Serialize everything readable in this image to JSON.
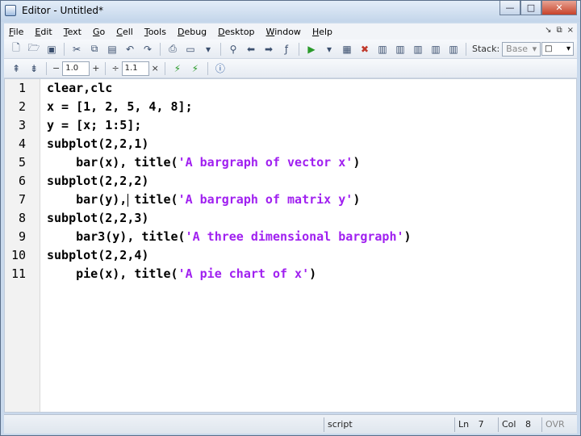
{
  "window": {
    "title": "Editor - Untitled*",
    "minimize": "—",
    "maximize": "□",
    "close": "✕"
  },
  "menu": {
    "items": [
      "File",
      "Edit",
      "Text",
      "Go",
      "Cell",
      "Tools",
      "Debug",
      "Desktop",
      "Window",
      "Help"
    ],
    "right_icons": [
      "↘",
      "⧉",
      "×"
    ]
  },
  "toolbar1": {
    "icons": [
      "new-file-icon",
      "open-folder-icon",
      "save-icon",
      "cut-icon",
      "copy-icon",
      "paste-icon",
      "undo-icon",
      "redo-icon",
      "print-icon",
      "find-icon",
      "back-icon",
      "forward-icon",
      "function-icon",
      "run-icon",
      "breakpoint-icon",
      "clear-breakpoints-icon",
      "step-icon"
    ],
    "stack_label": "Stack:",
    "stack_value": "Base",
    "fx_label": "fx"
  },
  "toolbar2": {
    "minus": "−",
    "value1": "1.0",
    "plus": "+",
    "divide": "÷",
    "value2": "1.1",
    "times": "×"
  },
  "editor": {
    "line_numbers": [
      "1",
      "2",
      "3",
      "4",
      "5",
      "6",
      "7",
      "8",
      "9",
      "10",
      "11"
    ],
    "lines": [
      {
        "indent": "",
        "code": "clear,clc",
        "str": "",
        "tail": ""
      },
      {
        "indent": "",
        "code": "x = [1, 2, 5, 4, 8];",
        "str": "",
        "tail": ""
      },
      {
        "indent": "",
        "code": "y = [x; 1:5];",
        "str": "",
        "tail": ""
      },
      {
        "indent": "",
        "code": "subplot(2,2,1)",
        "str": "",
        "tail": ""
      },
      {
        "indent": "    ",
        "code": "bar(x), title(",
        "str": "'A bargraph of vector x'",
        "tail": ")"
      },
      {
        "indent": "",
        "code": "subplot(2,2,2)",
        "str": "",
        "tail": ""
      },
      {
        "indent": "    ",
        "code": "bar(y), title(",
        "str": "'A bargraph of matrix y'",
        "tail": ")"
      },
      {
        "indent": "",
        "code": "subplot(2,2,3)",
        "str": "",
        "tail": ""
      },
      {
        "indent": "    ",
        "code": "bar3(y), title(",
        "str": "'A three dimensional bargraph'",
        "tail": ")"
      },
      {
        "indent": "",
        "code": "subplot(2,2,4)",
        "str": "",
        "tail": ""
      },
      {
        "indent": "    ",
        "code": "pie(x), title(",
        "str": "'A pie chart of x'",
        "tail": ")"
      }
    ]
  },
  "status": {
    "mode": "script",
    "ln_label": "Ln",
    "ln_value": "7",
    "col_label": "Col",
    "col_value": "8",
    "ovr": "OVR"
  },
  "colors": {
    "string": "#a020f0",
    "keyword": "#000000"
  }
}
